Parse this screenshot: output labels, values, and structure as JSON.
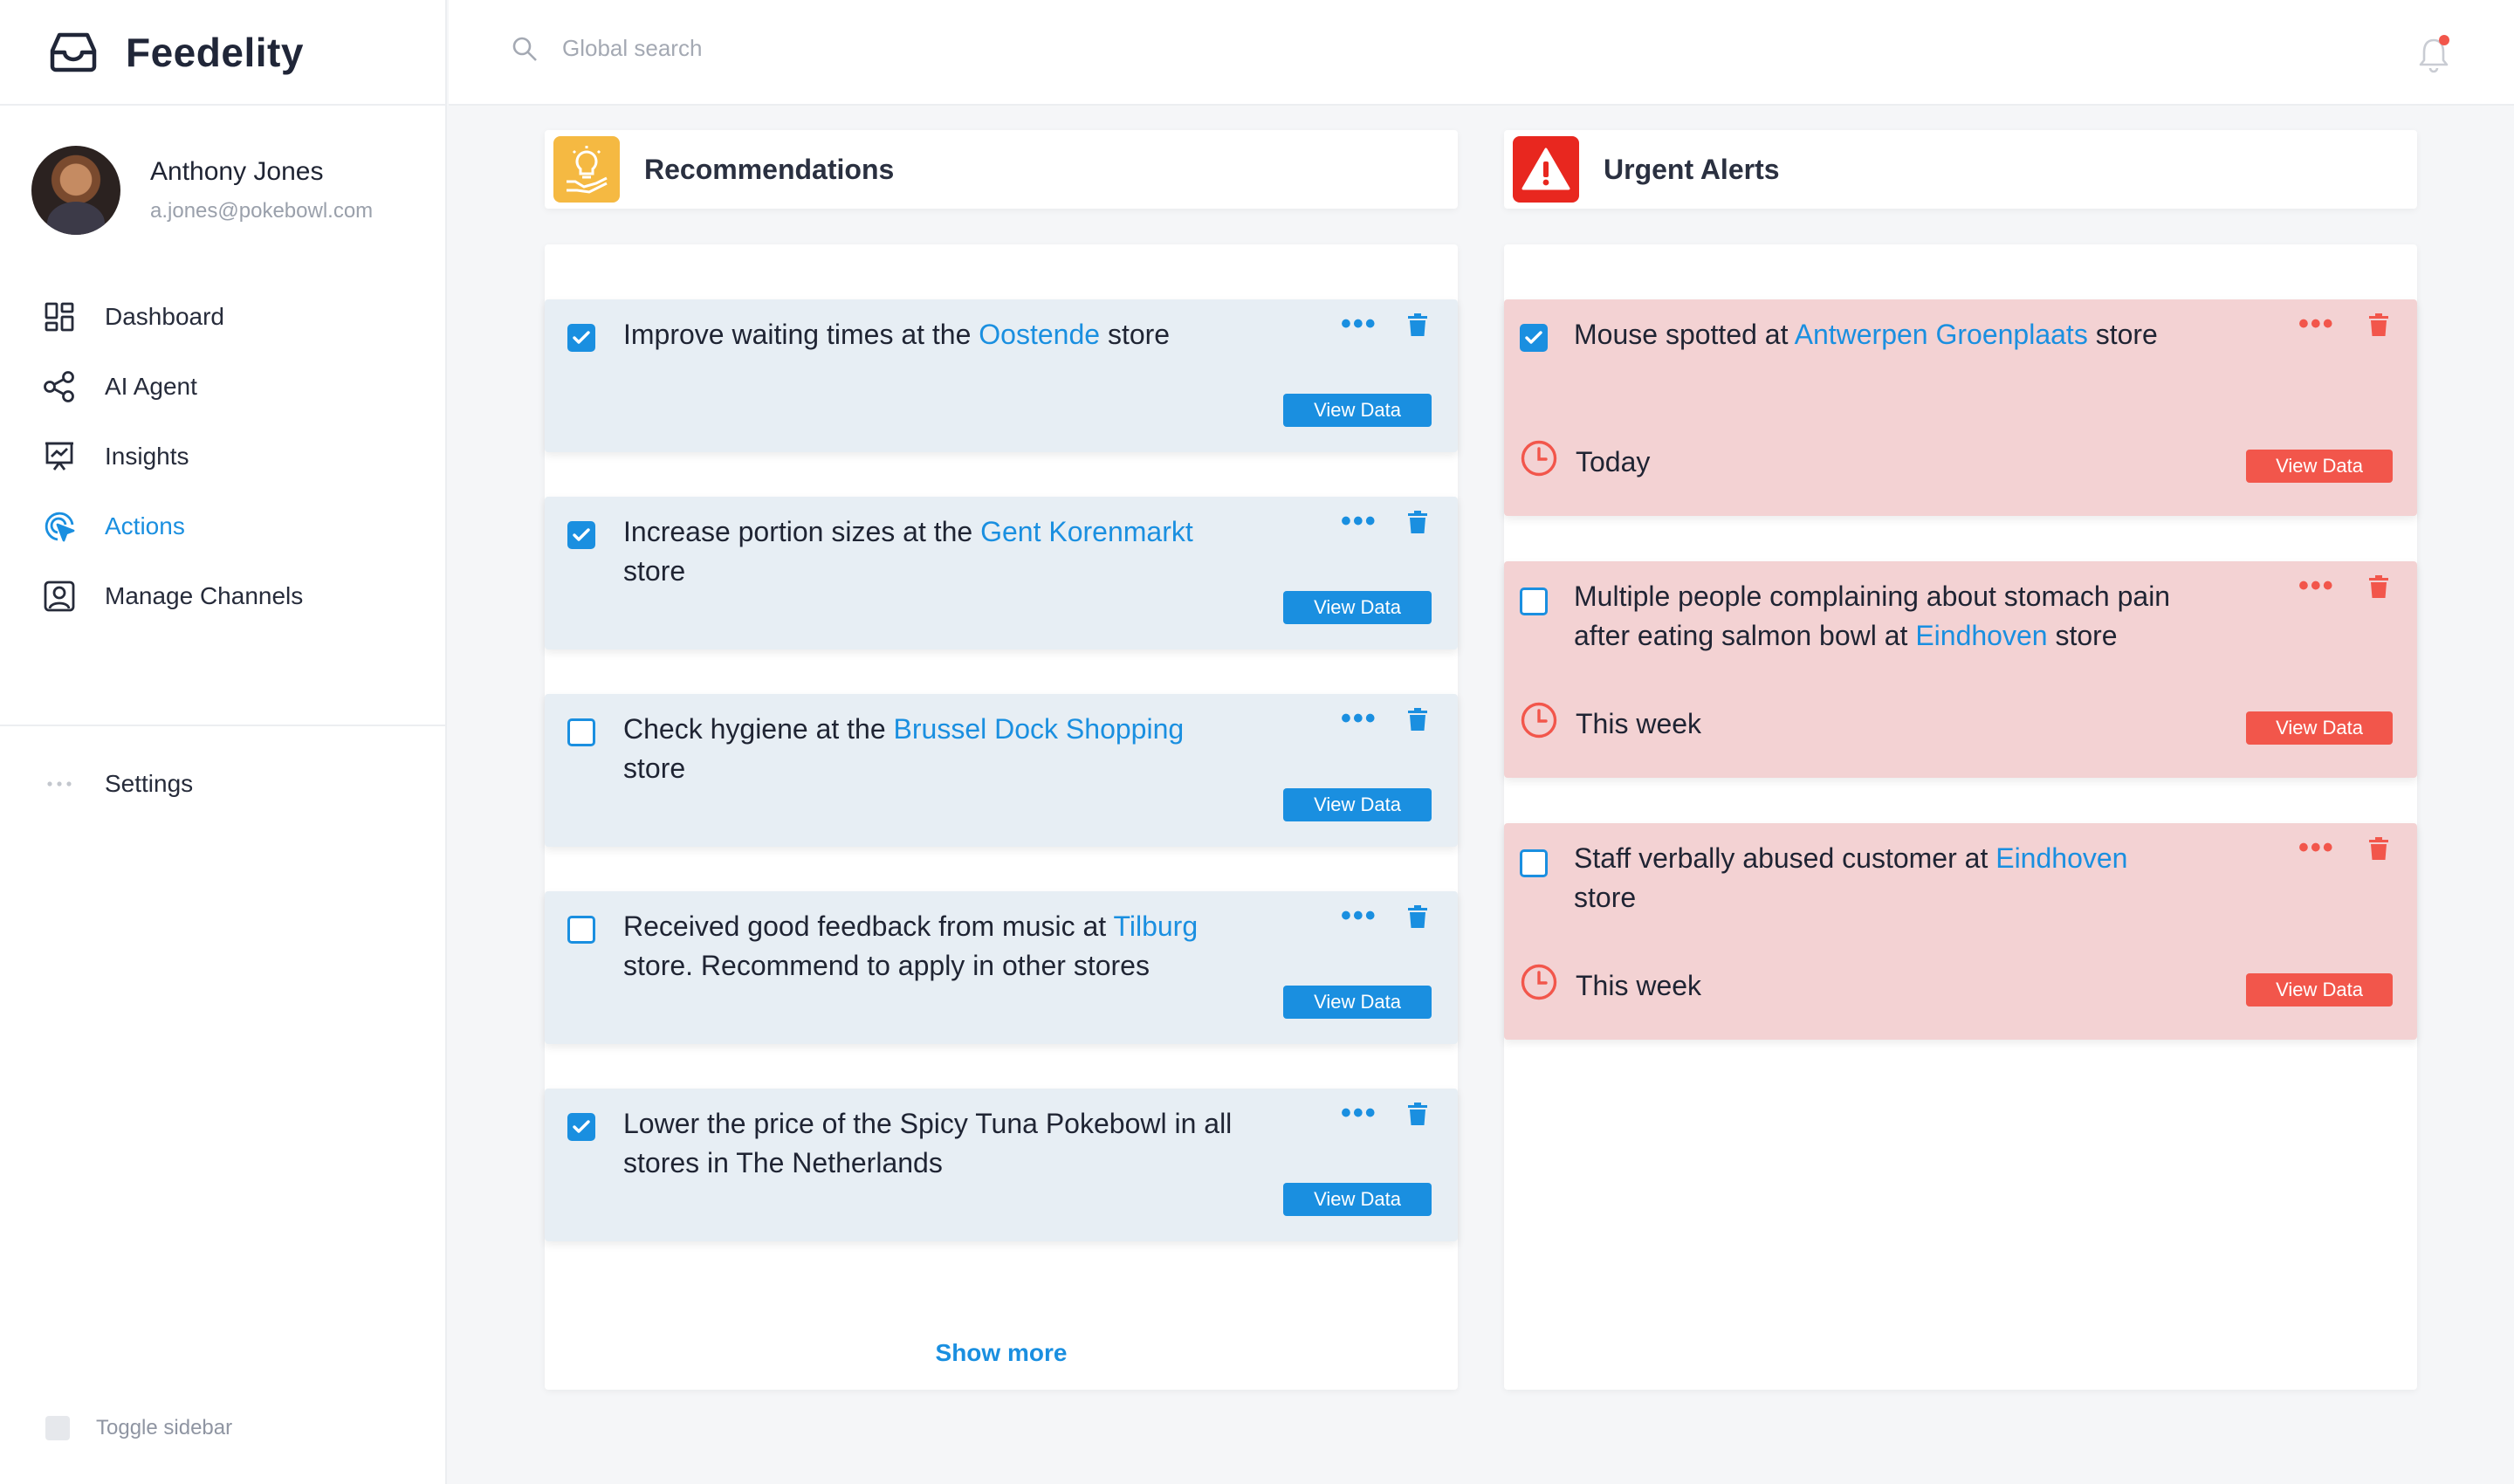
{
  "app": {
    "name": "Feedelity"
  },
  "user": {
    "name": "Anthony Jones",
    "email": "a.jones@pokebowl.com"
  },
  "nav": {
    "items": [
      {
        "label": "Dashboard",
        "icon": "dashboard-icon"
      },
      {
        "label": "AI Agent",
        "icon": "share-nodes-icon"
      },
      {
        "label": "Insights",
        "icon": "presentation-chart-icon"
      },
      {
        "label": "Actions",
        "icon": "cursor-target-icon",
        "active": true
      },
      {
        "label": "Manage Channels",
        "icon": "contact-card-icon"
      }
    ],
    "settings_label": "Settings",
    "toggle_label": "Toggle sidebar"
  },
  "search": {
    "placeholder": "Global search"
  },
  "recommendations": {
    "title": "Recommendations",
    "view_label": "View Data",
    "show_more": "Show more",
    "items": [
      {
        "checked": true,
        "pre": "Improve waiting times at the ",
        "highlight": "Oostende",
        "post": " store"
      },
      {
        "checked": true,
        "pre": "Increase portion sizes at the ",
        "highlight": "Gent Korenmarkt",
        "post": " store"
      },
      {
        "checked": false,
        "pre": "Check hygiene at the ",
        "highlight": "Brussel Dock Shopping",
        "post": " store"
      },
      {
        "checked": false,
        "pre": "Received good feedback from music at ",
        "highlight": "Tilburg",
        "post": " store. Recommend to apply in other stores"
      },
      {
        "checked": true,
        "pre": "Lower the price of the Spicy Tuna Pokebowl in all stores in The Netherlands",
        "highlight": "",
        "post": ""
      }
    ]
  },
  "alerts": {
    "title": "Urgent Alerts",
    "view_label": "View Data",
    "items": [
      {
        "checked": true,
        "pre": "Mouse spotted at ",
        "highlight": "Antwerpen Groenplaats",
        "post": " store",
        "time": "Today"
      },
      {
        "checked": false,
        "pre": "Multiple people complaining about stomach pain after eating salmon bowl at ",
        "highlight": "Eindhoven",
        "post": " store",
        "time": "This week"
      },
      {
        "checked": false,
        "pre": "Staff verbally abused customer at ",
        "highlight": "Eindhoven",
        "post": " store",
        "time": "This week"
      }
    ]
  },
  "colors": {
    "accent": "#1a8fe0",
    "alert": "#f2564b",
    "rec_card": "#e7eef4",
    "alert_card": "#f3d2d3",
    "bulb_badge": "#f5b942",
    "alert_badge": "#e8271f"
  }
}
